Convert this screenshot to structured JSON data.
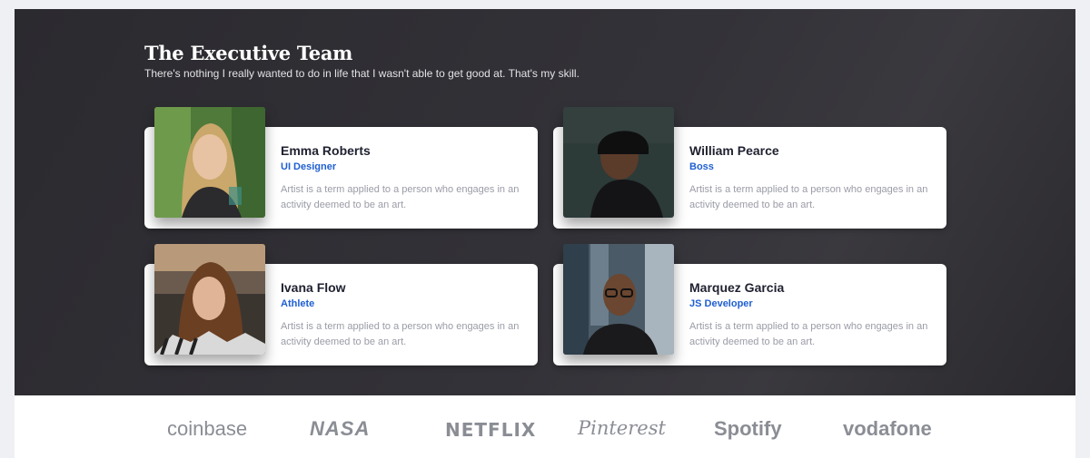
{
  "section": {
    "title": "The Executive Team",
    "subtitle": "There's nothing I really wanted to do in life that I wasn't able to get good at. That's my skill."
  },
  "team": [
    {
      "name": "Emma Roberts",
      "role": "UI Designer",
      "description": "Artist is a term applied to a person who engages in an activity deemed to be an art."
    },
    {
      "name": "William Pearce",
      "role": "Boss",
      "description": "Artist is a term applied to a person who engages in an activity deemed to be an art."
    },
    {
      "name": "Ivana Flow",
      "role": "Athlete",
      "description": "Artist is a term applied to a person who engages in an activity deemed to be an art."
    },
    {
      "name": "Marquez Garcia",
      "role": "JS Developer",
      "description": "Artist is a term applied to a person who engages in an activity deemed to be an art."
    }
  ],
  "logos": [
    "coinbase",
    "NASA",
    "NETFLIX",
    "Pinterest",
    "Spotify",
    "vodafone"
  ],
  "colors": {
    "role_accent": "#1f5fd1",
    "logo_gray": "#8b8d95",
    "section_bg": "#2f2e33"
  }
}
